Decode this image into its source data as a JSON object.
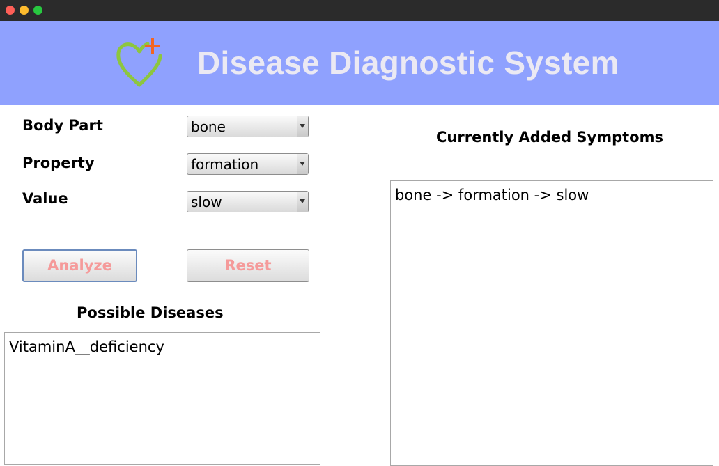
{
  "window": {
    "controls": [
      "close",
      "minimize",
      "maximize"
    ]
  },
  "header": {
    "title": "Disease Diagnostic System",
    "logo_icon": "heart-plus-icon"
  },
  "form": {
    "body_part": {
      "label": "Body Part",
      "value": "bone"
    },
    "property": {
      "label": "Property",
      "value": "formation"
    },
    "value": {
      "label": "Value",
      "value": "slow"
    }
  },
  "buttons": {
    "analyze": "Analyze",
    "reset": "Reset"
  },
  "diseases": {
    "title": "Possible Diseases",
    "items": [
      "VitaminA__deficiency"
    ]
  },
  "symptoms": {
    "title": "Currently Added Symptoms",
    "items": [
      "bone -> formation -> slow"
    ]
  },
  "colors": {
    "header_bg": "#8fa1fe",
    "title_text": "#ebe9f3",
    "button_text": "#f59a9a",
    "logo_green": "#8dc63f",
    "logo_orange": "#f26522"
  }
}
